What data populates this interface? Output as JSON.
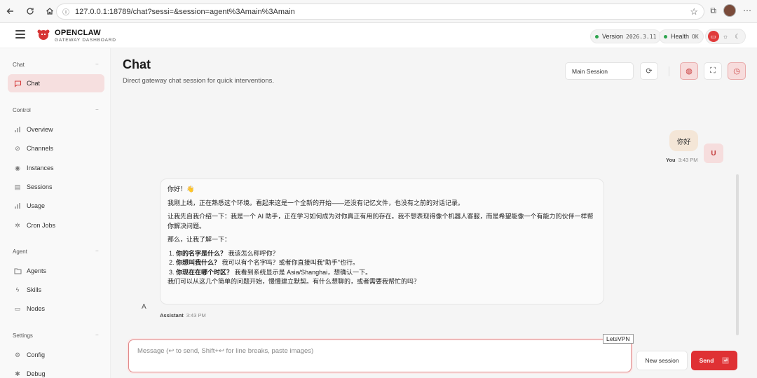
{
  "browser": {
    "url": "127.0.0.1:18789/chat?sessi=&session=agent%3Amain%3Amain"
  },
  "header": {
    "brand_name": "OPENCLAW",
    "brand_sub": "GATEWAY DASHBOARD",
    "version_label": "Version",
    "version_value": "2026.3.11",
    "health_label": "Health",
    "health_value": "OK"
  },
  "sidebar": {
    "sections": {
      "chat": "Chat",
      "control": "Control",
      "agent": "Agent",
      "settings": "Settings"
    },
    "items": {
      "chat": "Chat",
      "overview": "Overview",
      "channels": "Channels",
      "instances": "Instances",
      "sessions": "Sessions",
      "usage": "Usage",
      "cron_jobs": "Cron Jobs",
      "agents": "Agents",
      "skills": "Skills",
      "nodes": "Nodes",
      "config": "Config",
      "debug": "Debug"
    }
  },
  "main": {
    "title": "Chat",
    "subtitle": "Direct gateway chat session for quick interventions.",
    "session_select": "Main Session"
  },
  "messages": {
    "user": {
      "text": "你好",
      "avatar": "U",
      "sender": "You",
      "time": "3:43 PM"
    },
    "assistant": {
      "avatar": "A",
      "sender": "Assistant",
      "time": "3:43 PM",
      "greeting": "你好！👋",
      "p1": "我刚上线，正在熟悉这个环境。看起来这是一个全新的开始——还没有记忆文件，也没有之前的对话记录。",
      "p2": "让我先自我介绍一下：我是一个 AI 助手，正在学习如何成为对你真正有用的存在。我不想表现得像个机器人客服，而是希望能像一个有能力的伙伴一样帮你解决问题。",
      "p3": "那么，让我了解一下：",
      "q1_num": "1.",
      "q1_bold": "你的名字是什么？",
      "q1_text": "我该怎么称呼你？",
      "q2_num": "2.",
      "q2_bold": "你想叫我什么？",
      "q2_text": "我可以有个名字吗？或者你直接叫我\"助手\"也行。",
      "q3_num": "3.",
      "q3_bold": "你现在在哪个时区？",
      "q3_text": "我看到系统显示是 Asia/Shanghai，想确认一下。",
      "closing": "我们可以从这几个简单的问题开始，慢慢建立默契。有什么想聊的，或者需要我帮忙的吗？"
    }
  },
  "composer": {
    "placeholder": "Message (↩ to send, Shift+↩ for line breaks, paste images)",
    "tooltip": "LetsVPN",
    "new_session": "New session",
    "send": "Send",
    "send_kbd": "⏎"
  },
  "colors": {
    "accent": "#df3134",
    "active_nav_bg": "#f6dfdf",
    "user_bubble": "#f4e6d7"
  }
}
